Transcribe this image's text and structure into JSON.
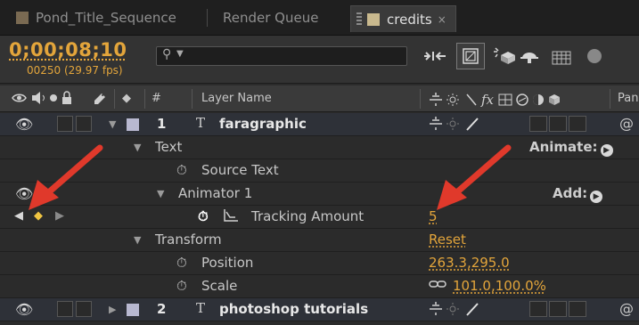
{
  "tabs": [
    {
      "label": "Pond_Title_Sequence",
      "active": false
    },
    {
      "label": "Render Queue",
      "active": false
    },
    {
      "label": "credits",
      "active": true
    }
  ],
  "controls": {
    "timecode": "0;00;08;10",
    "frames": "00250 (29.97 fps)",
    "search_placeholder": ""
  },
  "columns": {
    "index": "#",
    "layer_name": "Layer Name",
    "parent": "Pan"
  },
  "layers": [
    {
      "index": "1",
      "name": "faragraphic"
    },
    {
      "index": "2",
      "name": "photoshop tutorials"
    }
  ],
  "properties": {
    "text_group": "Text",
    "animate_label": "Animate:",
    "source_text": "Source Text",
    "animator": "Animator 1",
    "add_label": "Add:",
    "tracking": "Tracking Amount",
    "tracking_value": "5",
    "transform": "Transform",
    "reset": "Reset",
    "position": "Position",
    "position_value": "263.3,295.0",
    "scale": "Scale",
    "scale_value": "101.0,100.0%"
  },
  "colors": {
    "accent_orange": "#e3a53b",
    "annotation_red": "#e0392b",
    "keyframe": "#f0c542"
  }
}
